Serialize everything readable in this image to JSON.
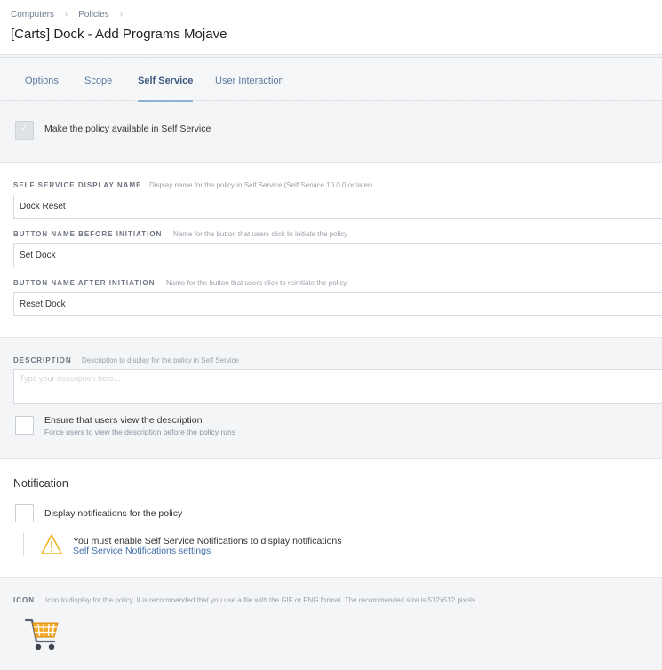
{
  "breadcrumb": {
    "items": [
      "Computers",
      "Policies"
    ],
    "separator": "›"
  },
  "page_title": "[Carts] Dock - Add Programs Mojave",
  "tabs": [
    {
      "label": "Options",
      "active": false
    },
    {
      "label": "Scope",
      "active": false
    },
    {
      "label": "Self Service",
      "active": true
    },
    {
      "label": "User Interaction",
      "active": false
    }
  ],
  "availability": {
    "label": "Make the policy available in Self Service",
    "checked": true
  },
  "display_name": {
    "label": "SELF SERVICE DISPLAY NAME",
    "hint": "Display name for the policy in Self Service (Self Service 10.0.0 or later)",
    "value": "Dock Reset"
  },
  "button_before": {
    "label": "BUTTON NAME BEFORE INITIATION",
    "hint": "Name for the button that users click to initiate the policy",
    "value": "Set Dock"
  },
  "button_after": {
    "label": "BUTTON NAME AFTER INITIATION",
    "hint": "Name for the button that users click to reinitiate the policy",
    "value": "Reset Dock"
  },
  "description": {
    "label": "DESCRIPTION",
    "hint": "Description to display for the policy in Self Service",
    "placeholder": "Type your description here...",
    "ensure_label": "Ensure that users view the description",
    "ensure_sub": "Force users to view the description before the policy runs",
    "ensure_checked": false
  },
  "notification": {
    "title": "Notification",
    "display_label": "Display notifications for the policy",
    "display_checked": false,
    "warning_text": "You must enable Self Service Notifications to display notifications",
    "warning_link": "Self Service Notifications settings"
  },
  "icon_section": {
    "label": "ICON",
    "hint": "Icon to display for the policy. It is recommended that you use a file with the GIF or PNG format. The recommended size is 512x512 pixels.",
    "icon_name": "shopping-cart-icon"
  },
  "colors": {
    "accent": "#3f6fa8",
    "tab_active_underline": "#8fb0d6",
    "warning": "#f0b429",
    "cart": "#f5a623"
  }
}
